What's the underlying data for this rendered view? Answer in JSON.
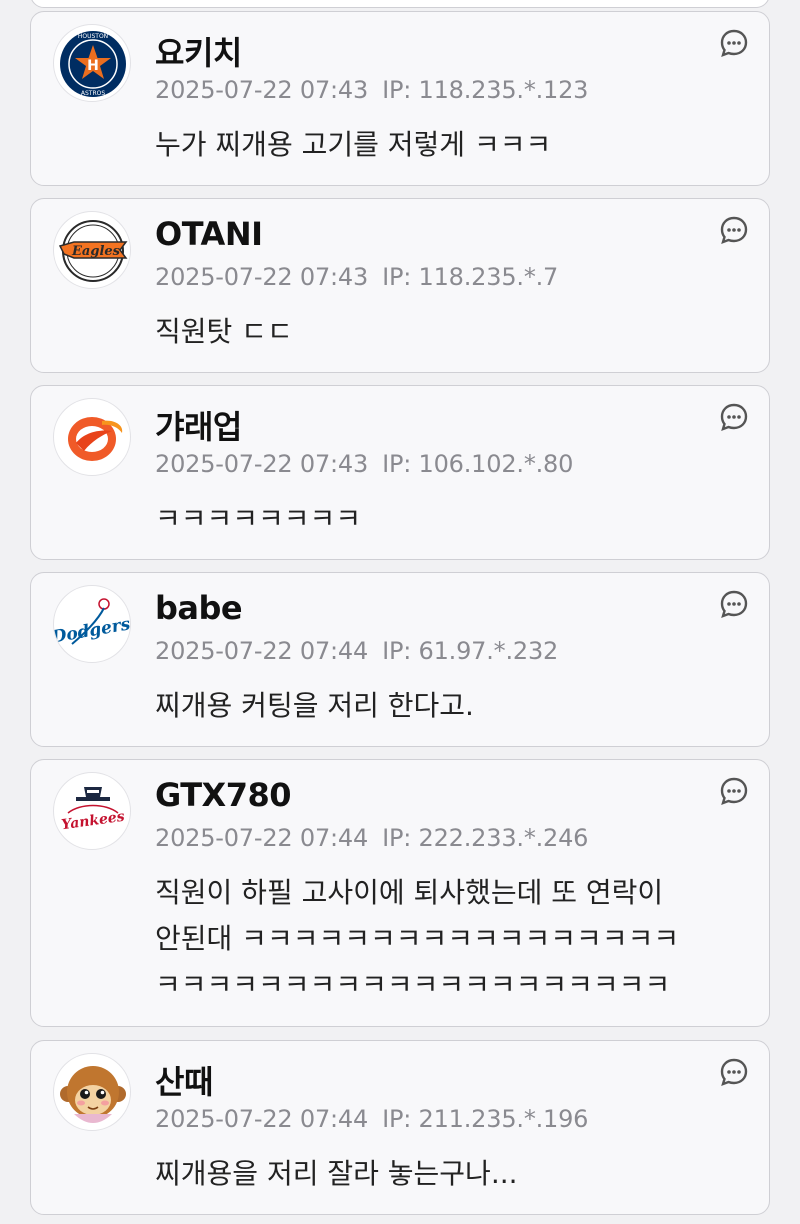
{
  "comments": [
    {
      "nick": "요키치",
      "date": "2025-07-22 07:43",
      "ip": "IP: 118.235.*.123",
      "text": "누가 찌개용 고기를 저렇게 ㅋㅋㅋ",
      "avatar": "astros-logo-icon"
    },
    {
      "nick": "OTANI",
      "date": "2025-07-22 07:43",
      "ip": "IP: 118.235.*.7",
      "text": "직원탓 ㄷㄷ",
      "avatar": "eagles-logo-icon"
    },
    {
      "nick": "갸래업",
      "date": "2025-07-22 07:43",
      "ip": "IP: 106.102.*.80",
      "text": "ㅋㅋㅋㅋㅋㅋㅋㅋ",
      "avatar": "orange-swirl-logo-icon"
    },
    {
      "nick": "babe",
      "date": "2025-07-22 07:44",
      "ip": "IP: 61.97.*.232",
      "text": "찌개용 커팅을 저리 한다고.",
      "avatar": "dodgers-logo-icon"
    },
    {
      "nick": "GTX780",
      "date": "2025-07-22 07:44",
      "ip": "IP: 222.233.*.246",
      "text": "직원이 하필 고사이에 퇴사했는데 또 연락이\n안된대 ㅋㅋㅋㅋㅋㅋㅋㅋㅋㅋㅋㅋㅋㅋㅋㅋㅋ\nㅋㅋㅋㅋㅋㅋㅋㅋㅋㅋㅋㅋㅋㅋㅋㅋㅋㅋㅋㅋ",
      "avatar": "yankees-logo-icon"
    },
    {
      "nick": "산때",
      "date": "2025-07-22 07:44",
      "ip": "IP: 211.235.*.196",
      "text": "찌개용을 저리 잘라 놓는구나...",
      "avatar": "monkey-character-icon"
    }
  ],
  "colors": {
    "card_bg": "#f8f8fa",
    "card_border": "#cfcfd4",
    "meta_text": "#8a8a90",
    "astros_navy": "#002d62",
    "astros_orange": "#eb6e1f",
    "eagles_orange": "#f37321",
    "dodgers_blue": "#005a9c",
    "yankees_red": "#c4122f"
  }
}
